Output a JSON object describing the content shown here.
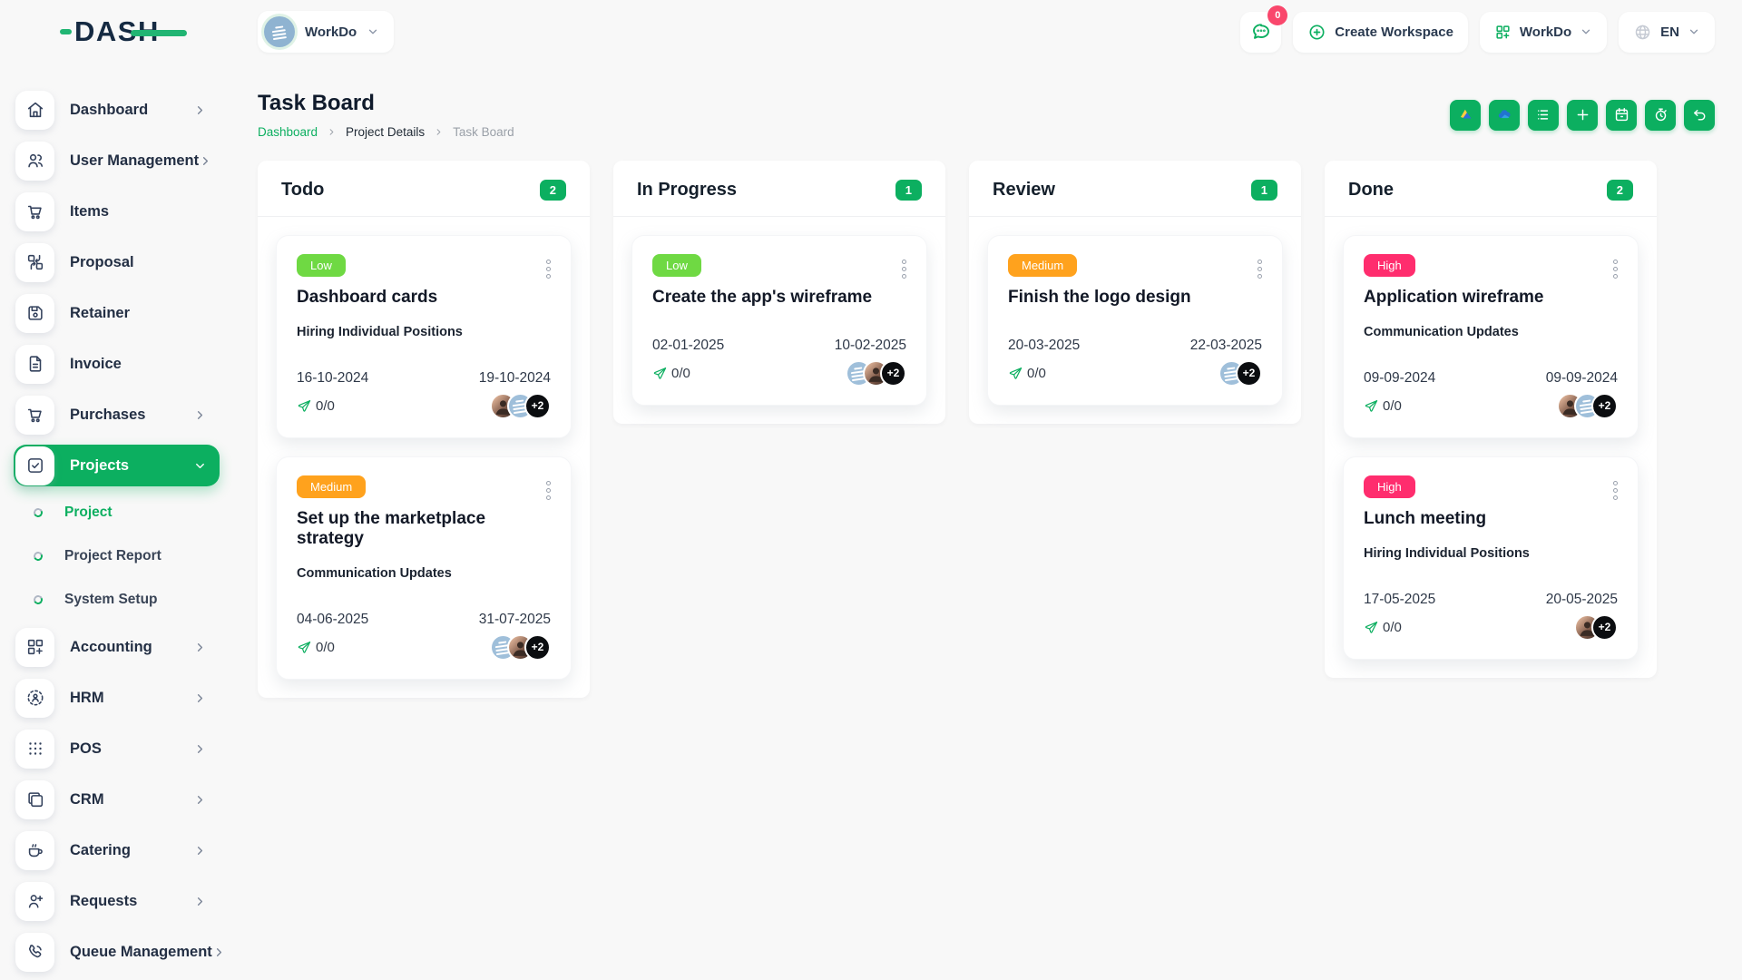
{
  "brand": {
    "name": "DASH"
  },
  "topbar": {
    "workspace_switcher": {
      "name": "WorkDo",
      "icon": "workdo-building-avatar"
    },
    "messages": {
      "icon": "chat-bubble-icon",
      "badge": "0"
    },
    "create_workspace": {
      "icon": "plus-circle-icon",
      "label": "Create Workspace"
    },
    "workspace_dropdown": {
      "icon": "grid-plus-icon",
      "label": "WorkDo"
    },
    "language": {
      "icon": "globe-icon",
      "code": "EN"
    }
  },
  "sidebar": {
    "items": [
      {
        "label": "Dashboard",
        "icon": "home-icon",
        "chevron": true
      },
      {
        "label": "User Management",
        "icon": "users-icon",
        "chevron": true
      },
      {
        "label": "Items",
        "icon": "cart-icon",
        "chevron": false
      },
      {
        "label": "Proposal",
        "icon": "proposal-icon",
        "chevron": false
      },
      {
        "label": "Retainer",
        "icon": "retainer-icon",
        "chevron": false
      },
      {
        "label": "Invoice",
        "icon": "invoice-icon",
        "chevron": false
      },
      {
        "label": "Purchases",
        "icon": "cart-icon",
        "chevron": true
      },
      {
        "label": "Projects",
        "icon": "check-square-icon",
        "chevron": true,
        "active": true
      },
      {
        "label": "Project",
        "sub": true,
        "active": true
      },
      {
        "label": "Project Report",
        "sub": true
      },
      {
        "label": "System Setup",
        "sub": true
      },
      {
        "label": "Accounting",
        "icon": "grid-plus-icon",
        "chevron": true
      },
      {
        "label": "HRM",
        "icon": "hrm-icon",
        "chevron": true
      },
      {
        "label": "POS",
        "icon": "dots-grid-icon",
        "chevron": true
      },
      {
        "label": "CRM",
        "icon": "copy-icon",
        "chevron": true
      },
      {
        "label": "Catering",
        "icon": "coffee-icon",
        "chevron": true
      },
      {
        "label": "Requests",
        "icon": "user-plus-icon",
        "chevron": true
      },
      {
        "label": "Queue Management",
        "icon": "phone-icon",
        "chevron": true
      }
    ]
  },
  "page": {
    "title": "Task Board",
    "breadcrumb": {
      "home": "Dashboard",
      "parent": "Project Details",
      "current": "Task Board"
    }
  },
  "toolbar": {
    "buttons": [
      {
        "name": "google-drive-icon"
      },
      {
        "name": "onedrive-icon"
      },
      {
        "name": "list-icon"
      },
      {
        "name": "plus-icon"
      },
      {
        "name": "calendar-icon"
      },
      {
        "name": "timer-icon"
      },
      {
        "name": "return-arrow-icon"
      }
    ]
  },
  "board": {
    "columns": [
      {
        "name": "Todo",
        "count": "2",
        "cards": [
          {
            "priority": "Low",
            "level": "low",
            "title": "Dashboard cards",
            "milestone": "Hiring Individual Positions",
            "start_date": "16-10-2024",
            "end_date": "19-10-2024",
            "progress": "0/0",
            "avatars": [
              "person-avatar",
              "workdo-avatar"
            ],
            "extra_count": "+2"
          },
          {
            "priority": "Medium",
            "level": "medium",
            "title": "Set up the marketplace strategy",
            "milestone": "Communication Updates",
            "start_date": "04-06-2025",
            "end_date": "31-07-2025",
            "progress": "0/0",
            "avatars": [
              "workdo-avatar",
              "person-avatar"
            ],
            "extra_count": "+2"
          }
        ]
      },
      {
        "name": "In Progress",
        "count": "1",
        "cards": [
          {
            "priority": "Low",
            "level": "low",
            "title": "Create the app's wireframe",
            "milestone": "",
            "start_date": "02-01-2025",
            "end_date": "10-02-2025",
            "progress": "0/0",
            "avatars": [
              "workdo-avatar",
              "person-avatar"
            ],
            "extra_count": "+2"
          }
        ]
      },
      {
        "name": "Review",
        "count": "1",
        "cards": [
          {
            "priority": "Medium",
            "level": "medium",
            "title": "Finish the logo design",
            "milestone": "",
            "start_date": "20-03-2025",
            "end_date": "22-03-2025",
            "progress": "0/0",
            "avatars": [
              "workdo-avatar"
            ],
            "extra_count": "+2"
          }
        ]
      },
      {
        "name": "Done",
        "count": "2",
        "cards": [
          {
            "priority": "High",
            "level": "high",
            "title": "Application wireframe",
            "milestone": "Communication Updates",
            "start_date": "09-09-2024",
            "end_date": "09-09-2024",
            "progress": "0/0",
            "avatars": [
              "person-avatar",
              "workdo-avatar"
            ],
            "extra_count": "+2"
          },
          {
            "priority": "High",
            "level": "high",
            "title": "Lunch meeting",
            "milestone": "Hiring Individual Positions",
            "start_date": "17-05-2025",
            "end_date": "20-05-2025",
            "progress": "0/0",
            "avatars": [
              "person-avatar"
            ],
            "extra_count": "+2"
          }
        ]
      }
    ]
  },
  "colors": {
    "primary": "#0CAF60",
    "low": "#6FD943",
    "medium": "#FFA21D",
    "high": "#FF2D6E",
    "notification_badge": "#F9476C",
    "extra_badge": "#0B0D10"
  }
}
